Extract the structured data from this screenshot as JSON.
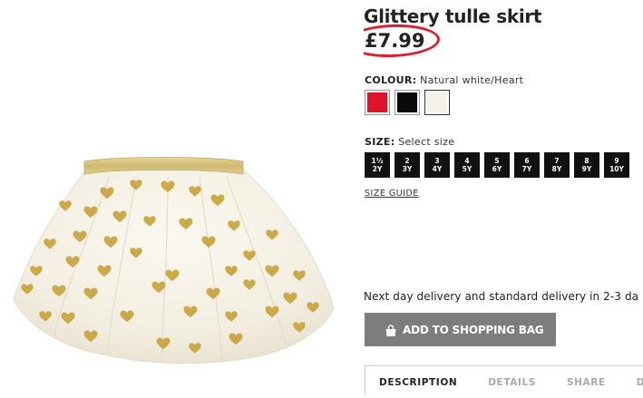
{
  "product": {
    "title": "Glittery tulle skirt",
    "price": "£7.99"
  },
  "colour": {
    "label": "COLOUR:",
    "selected": "Natural white/Heart",
    "swatches": [
      {
        "name": "Red",
        "color": "#e01428"
      },
      {
        "name": "Black",
        "color": "#0a0a0a"
      },
      {
        "name": "Natural white/Heart",
        "color": "#f5f1e8"
      }
    ]
  },
  "size": {
    "label": "SIZE:",
    "placeholder": "Select size",
    "options": [
      {
        "top": "1½",
        "bottom": "2Y"
      },
      {
        "top": "2",
        "bottom": "3Y"
      },
      {
        "top": "3",
        "bottom": "4Y"
      },
      {
        "top": "4",
        "bottom": "5Y"
      },
      {
        "top": "5",
        "bottom": "6Y"
      },
      {
        "top": "6",
        "bottom": "7Y"
      },
      {
        "top": "7",
        "bottom": "8Y"
      },
      {
        "top": "8",
        "bottom": "9Y"
      },
      {
        "top": "9",
        "bottom": "10Y"
      }
    ],
    "guide_label": "SIZE GUIDE"
  },
  "delivery_text": "Next day delivery and standard delivery in 2-3 da",
  "add_to_bag_label": "ADD TO SHOPPING BAG",
  "tabs": [
    "DESCRIPTION",
    "DETAILS",
    "SHARE",
    "DE"
  ],
  "colors": {
    "price_highlight": "#d8202e",
    "button_bg": "#7d7d7d",
    "skirt_base": "#faf7ef",
    "waistband": "#d8c483",
    "hearts": "#c9a43a"
  }
}
